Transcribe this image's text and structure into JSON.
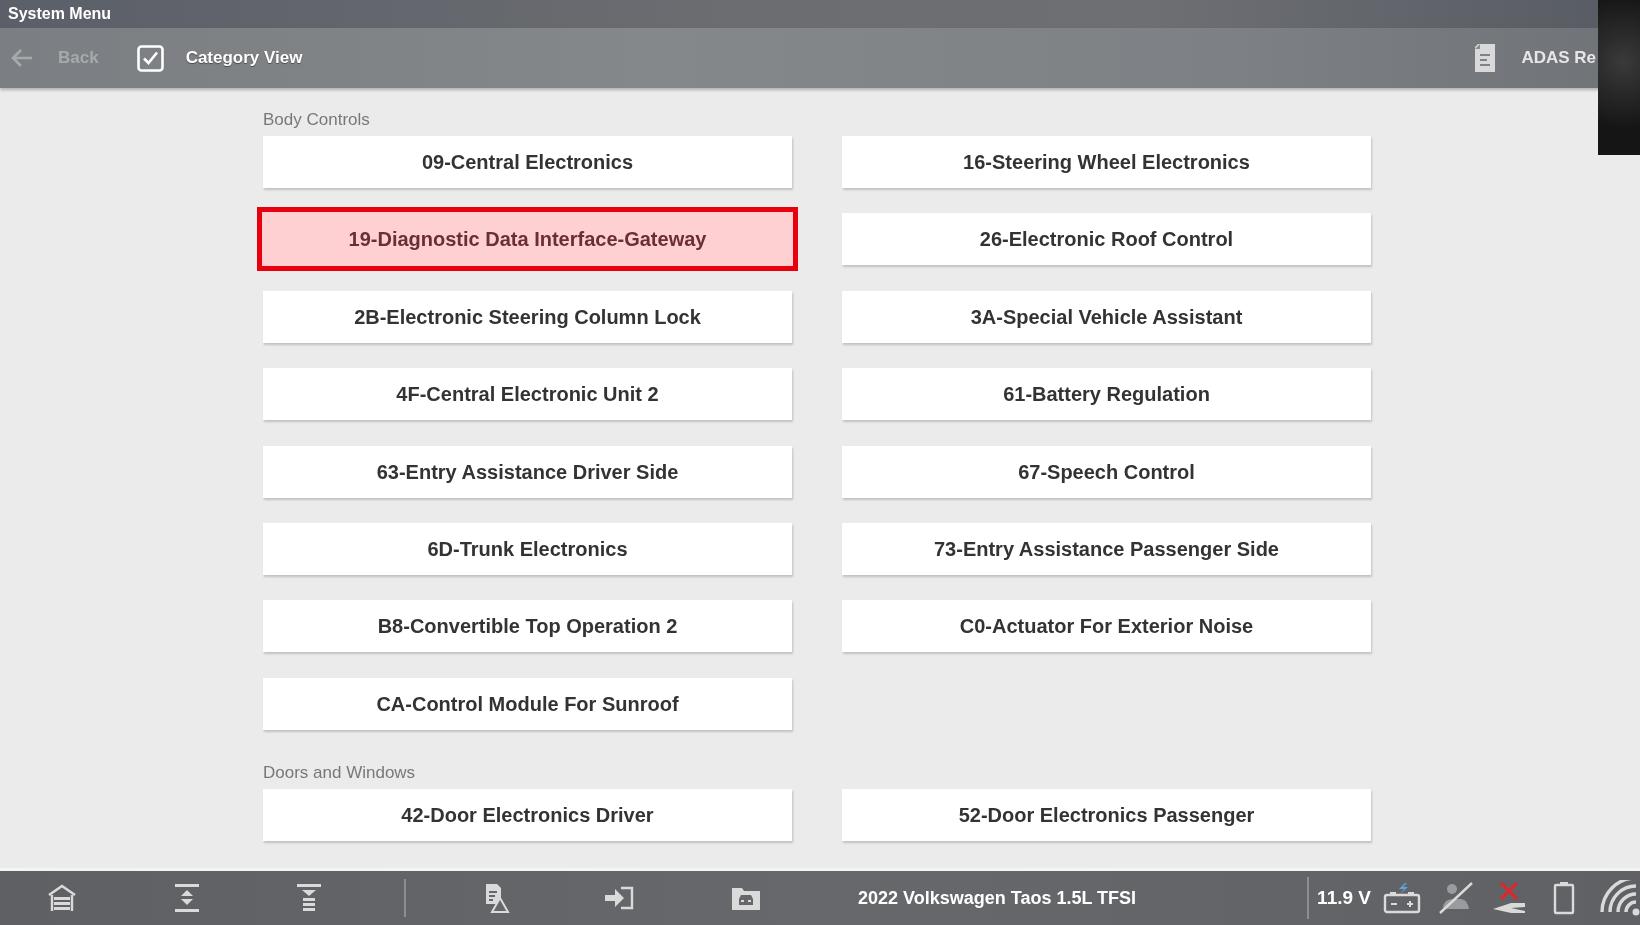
{
  "title_bar": {
    "title": "System Menu"
  },
  "toolbar": {
    "back_button": {
      "label": "Back",
      "disabled": true
    },
    "category_view": {
      "label": "Category View",
      "checked": true
    },
    "adas_button": {
      "label": "ADAS Re"
    }
  },
  "sections": [
    {
      "heading": "Body Controls",
      "modules": [
        {
          "label": "09-Central Electronics",
          "selected": false
        },
        {
          "label": "16-Steering Wheel Electronics",
          "selected": false
        },
        {
          "label": "19-Diagnostic Data Interface-Gateway",
          "selected": true
        },
        {
          "label": "26-Electronic Roof Control",
          "selected": false
        },
        {
          "label": "2B-Electronic Steering Column Lock",
          "selected": false
        },
        {
          "label": "3A-Special Vehicle Assistant",
          "selected": false
        },
        {
          "label": "4F-Central Electronic Unit 2",
          "selected": false
        },
        {
          "label": "61-Battery Regulation",
          "selected": false
        },
        {
          "label": "63-Entry Assistance Driver Side",
          "selected": false
        },
        {
          "label": "67-Speech Control",
          "selected": false
        },
        {
          "label": "6D-Trunk Electronics",
          "selected": false
        },
        {
          "label": "73-Entry Assistance Passenger Side",
          "selected": false
        },
        {
          "label": "B8-Convertible Top Operation 2",
          "selected": false
        },
        {
          "label": "C0-Actuator For Exterior Noise",
          "selected": false
        },
        {
          "label": "CA-Control Module For Sunroof",
          "selected": false
        }
      ]
    },
    {
      "heading": "Doors and Windows",
      "modules": [
        {
          "label": "42-Door Electronics Driver",
          "selected": false
        },
        {
          "label": "52-Door Electronics Passenger",
          "selected": false
        }
      ]
    }
  ],
  "status_bar": {
    "vehicle": "2022 Volkswagen Taos 1.5L TFSI",
    "voltage": "11.9 V"
  }
}
